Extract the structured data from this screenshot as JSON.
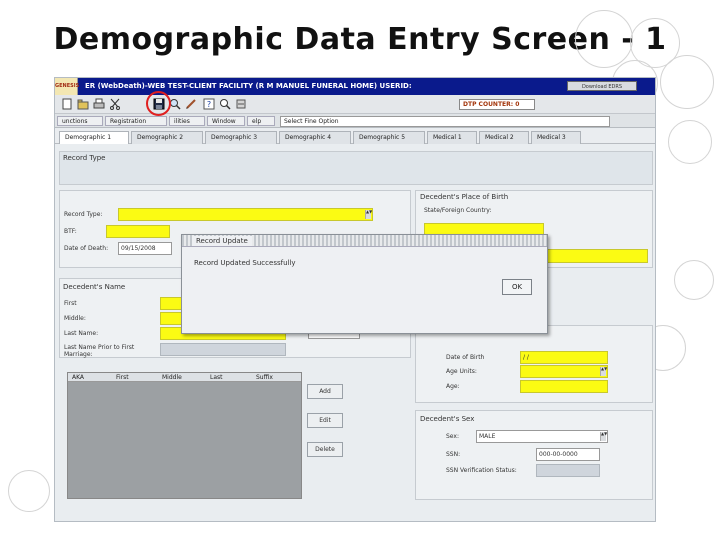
{
  "slide": {
    "title": "Demographic Data Entry Screen - 1"
  },
  "app": {
    "logo_text": "GENESIS",
    "title": "ER (WebDeath)-WEB TEST-CLIENT FACILITY (R M MANUEL FUNERAL HOME) USERID:",
    "window_button": "Download EDRS",
    "dtp_counter": "DTP COUNTER: 0",
    "colors": {
      "titlebar": "#0a1a8c",
      "required_field": "#fbfb13",
      "highlight_circle": "#e02020"
    }
  },
  "toolbar": {
    "icons": [
      "new-icon",
      "open-icon",
      "print-icon",
      "cut-icon",
      "save-icon",
      "search-icon",
      "edit-icon",
      "help-icon",
      "search-icon",
      "tools-icon"
    ]
  },
  "menu": {
    "items": [
      "unctions",
      "Registration",
      "ilities",
      "Window",
      "elp"
    ],
    "select_option": "Select Fine Option"
  },
  "tabs": [
    "Demographic 1",
    "Demographic 2",
    "Demographic 3",
    "Demographic 4",
    "Demographic 5",
    "Medical 1",
    "Medical 2",
    "Medical 3"
  ],
  "record_type": {
    "heading": "Record Type"
  },
  "left_form": {
    "record_type_label": "Record Type:",
    "bt_label": "BTF:",
    "date_of_death_label": "Date of Death:",
    "date_of_death_value": "09/15/2008"
  },
  "place_of_birth": {
    "heading": "Decedent's Place of Birth",
    "state_label": "State/Foreign Country:"
  },
  "decedent_name": {
    "heading": "Decedent's Name",
    "first_label": "First",
    "middle_label": "Middle:",
    "last_label": "Last Name:",
    "prior_label": "Last Name Prior to First Marriage:"
  },
  "aka_grid": {
    "columns": [
      "AKA",
      "First",
      "Middle",
      "Last",
      "Suffix"
    ]
  },
  "aka_buttons": {
    "add": "Add",
    "edit": "Edit",
    "delete": "Delete"
  },
  "age_block": {
    "dob_label": "Date of Birth",
    "dob_value": "/ /",
    "age_units_label": "Age Units:",
    "age_label": "Age:"
  },
  "sex": {
    "heading": "Decedent's Sex",
    "sex_label": "Sex:",
    "sex_value": "MALE",
    "ssn_label": "SSN:",
    "ssn_value": "000-00-0000",
    "ssn_verification_label": "SSN Verification Status:"
  },
  "dialog": {
    "title": "Record Update",
    "message": "Record Updated Successfully",
    "ok_label": "OK"
  }
}
